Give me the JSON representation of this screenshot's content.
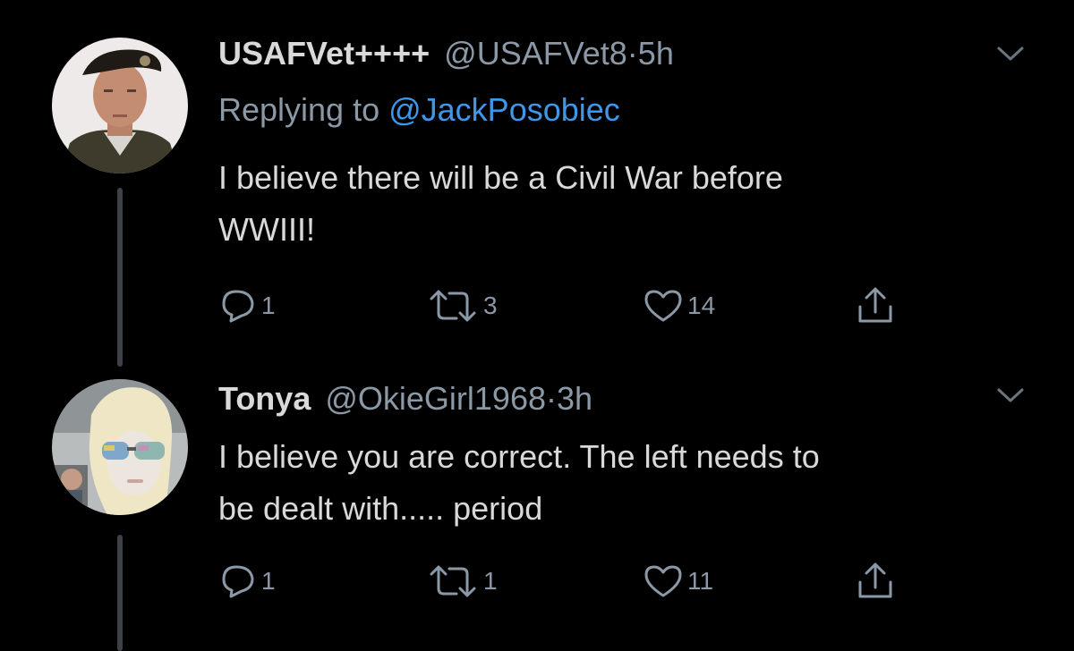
{
  "colors": {
    "background": "#000000",
    "primary_text": "#d9d9d9",
    "secondary_text": "#8b98a5",
    "link": "#3e97e8",
    "thread_line": "#3d4148"
  },
  "tweets": [
    {
      "display_name": "USAFVet++++",
      "handle": "@USAFVet8",
      "separator": "·",
      "time": "5h",
      "replying_prefix": "Replying to ",
      "replying_to": "@JackPosobiec",
      "text_line1": "I believe there will be a Civil War before",
      "text_line2": "WWIII!",
      "reply_count": "1",
      "retweet_count": "3",
      "like_count": "14",
      "icons": [
        "chevron-down-icon",
        "reply-icon",
        "retweet-icon",
        "heart-icon",
        "share-icon"
      ]
    },
    {
      "display_name": "Tonya",
      "handle": "@OkieGirl1968",
      "separator": "·",
      "time": "3h",
      "text_line1": "I believe you are correct.  The left needs to",
      "text_line2": "be dealt with..... period",
      "reply_count": "1",
      "retweet_count": "1",
      "like_count": "11",
      "icons": [
        "chevron-down-icon",
        "reply-icon",
        "retweet-icon",
        "heart-icon",
        "share-icon"
      ]
    }
  ]
}
